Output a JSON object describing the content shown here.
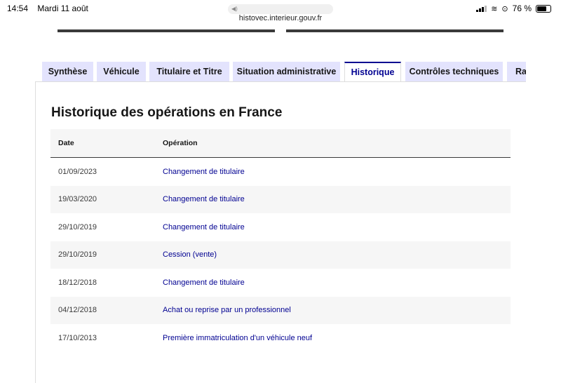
{
  "status_bar": {
    "time": "14:54",
    "date": "Mardi 11 août",
    "battery": "76 %",
    "url": "histovec.interieur.gouv.fr"
  },
  "tabs": [
    {
      "label": "Synthèse"
    },
    {
      "label": "Véhicule"
    },
    {
      "label": "Titulaire et Titre"
    },
    {
      "label": "Situation administrative"
    },
    {
      "label": "Historique",
      "active": true
    },
    {
      "label": "Contrôles techniques"
    },
    {
      "label": "Rap"
    }
  ],
  "section": {
    "title": "Historique des opérations en France"
  },
  "table": {
    "headers": {
      "date": "Date",
      "operation": "Opération"
    },
    "rows": [
      {
        "date": "01/09/2023",
        "operation": "Changement de titulaire"
      },
      {
        "date": "19/03/2020",
        "operation": "Changement de titulaire"
      },
      {
        "date": "29/10/2019",
        "operation": "Changement de titulaire"
      },
      {
        "date": "29/10/2019",
        "operation": "Cession (vente)"
      },
      {
        "date": "18/12/2018",
        "operation": "Changement de titulaire"
      },
      {
        "date": "04/12/2018",
        "operation": "Achat ou reprise par un professionnel"
      },
      {
        "date": "17/10/2013",
        "operation": "Première immatriculation d'un véhicule neuf"
      }
    ]
  },
  "colors": {
    "accent": "#000091",
    "tab_bg": "#e3e3fd",
    "row_alt": "#f6f6f6"
  },
  "battery_level": 0.76
}
